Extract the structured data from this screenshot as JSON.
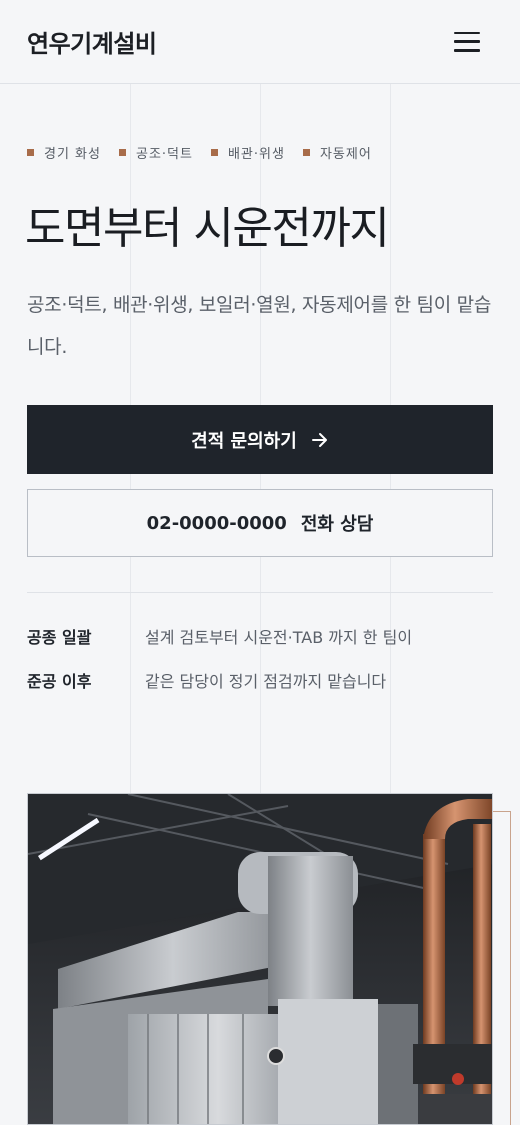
{
  "header": {
    "brand": "연우기계설비",
    "menu_icon": "hamburger-menu-icon"
  },
  "tags": [
    "경기 화성",
    "공조·덕트",
    "배관·위생",
    "자동제어"
  ],
  "hero": {
    "title": "도면부터 시운전까지",
    "description": "공조·덕트, 배관·위생, 보일러·열원, 자동제어를 한 팀이 맡습니다."
  },
  "cta": {
    "primary_label": "견적 문의하기",
    "primary_icon": "arrow-right-icon",
    "phone": "02-0000-0000",
    "phone_suffix": "전화 상담"
  },
  "info": [
    {
      "key": "공종 일괄",
      "value": "설계 검토부터 시운전·TAB 까지 한 팀이"
    },
    {
      "key": "준공 이후",
      "value": "같은 담당이 정기 점검까지 맡습니다"
    }
  ],
  "colors": {
    "accent": "#a86c4a",
    "dark": "#1f242b",
    "background": "#f5f6f8"
  }
}
